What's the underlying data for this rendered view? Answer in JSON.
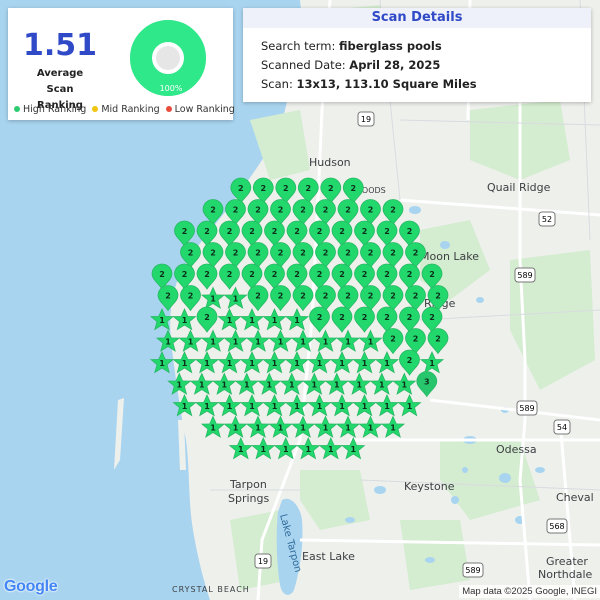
{
  "summary": {
    "average_value": "1.51",
    "average_label_line1": "Average",
    "average_label_line2": "Scan Ranking",
    "high_ranking_fraction": 1.0,
    "high_ranking_percent_label": "100%"
  },
  "legend": {
    "items": [
      {
        "label": "High Ranking",
        "color": "#2ecc71"
      },
      {
        "label": "Mid Ranking",
        "color": "#f1c40f"
      },
      {
        "label": "Low Ranking",
        "color": "#e74c3c"
      }
    ]
  },
  "details": {
    "title": "Scan Details",
    "search_prefix": "Search term: ",
    "search_term": "fiberglass pools",
    "date_prefix": "Scanned Date: ",
    "date": "April 28, 2025",
    "scan_prefix": "Scan: ",
    "scan": "13x13, 113.10 Square Miles"
  },
  "map_labels": {
    "hudson": "Hudson",
    "quail_ridge": "Quail Ridge",
    "moon_lake": "Moon Lake",
    "odessa": "Odessa",
    "keystone": "Keystone",
    "cheval": "Cheval",
    "tarpon": "Tarpon",
    "springs": "Springs",
    "east_lake": "East Lake",
    "lake_tarpon": "Lake Tarpon",
    "greater": "Greater",
    "northdale": "Northdale",
    "crystal_beach": "CRYSTAL BEACH",
    "woods": "WOODS",
    "ridge": "Ridge"
  },
  "road_shields": [
    "19",
    "52",
    "589",
    "589",
    "54",
    "19",
    "568",
    "589"
  ],
  "google_logo": "Google",
  "attribution": "Map data ©2025 Google, INEGI",
  "colors": {
    "accent": "#2f49c7",
    "pin_fill": "#22d86c",
    "pin_fill_dark": "#27b864",
    "water": "#a9d4f0",
    "land": "#eef0ec",
    "park": "#d4ecd0"
  },
  "pin_rows": [
    {
      "ranks": [
        2,
        2,
        2,
        2,
        2,
        2
      ]
    },
    {
      "ranks": [
        2,
        2,
        2,
        2,
        2,
        2,
        2,
        2,
        2
      ]
    },
    {
      "ranks": [
        2,
        2,
        2,
        2,
        2,
        2,
        2,
        2,
        2,
        2,
        2
      ]
    },
    {
      "ranks": [
        2,
        2,
        2,
        2,
        2,
        2,
        2,
        2,
        2,
        2,
        2
      ]
    },
    {
      "ranks": [
        2,
        2,
        2,
        2,
        2,
        2,
        2,
        2,
        2,
        2,
        2,
        2,
        2
      ]
    },
    {
      "ranks": [
        2,
        2,
        1,
        1,
        2,
        2,
        2,
        2,
        2,
        2,
        2,
        2,
        2
      ]
    },
    {
      "ranks": [
        1,
        1,
        2,
        1,
        1,
        1,
        1,
        2,
        2,
        2,
        2,
        2,
        2
      ]
    },
    {
      "ranks": [
        1,
        1,
        1,
        1,
        1,
        1,
        1,
        1,
        1,
        1,
        2,
        2,
        2
      ]
    },
    {
      "ranks": [
        1,
        1,
        1,
        1,
        1,
        1,
        1,
        1,
        1,
        1,
        1,
        2,
        1
      ]
    },
    {
      "ranks": [
        1,
        1,
        1,
        1,
        1,
        1,
        1,
        1,
        1,
        1,
        1,
        3
      ]
    },
    {
      "ranks": [
        1,
        1,
        1,
        1,
        1,
        1,
        1,
        1,
        1,
        1,
        1
      ]
    },
    {
      "ranks": [
        1,
        1,
        1,
        1,
        1,
        1,
        1,
        1,
        1
      ]
    },
    {
      "ranks": [
        1,
        1,
        1,
        1,
        1,
        1
      ]
    }
  ]
}
